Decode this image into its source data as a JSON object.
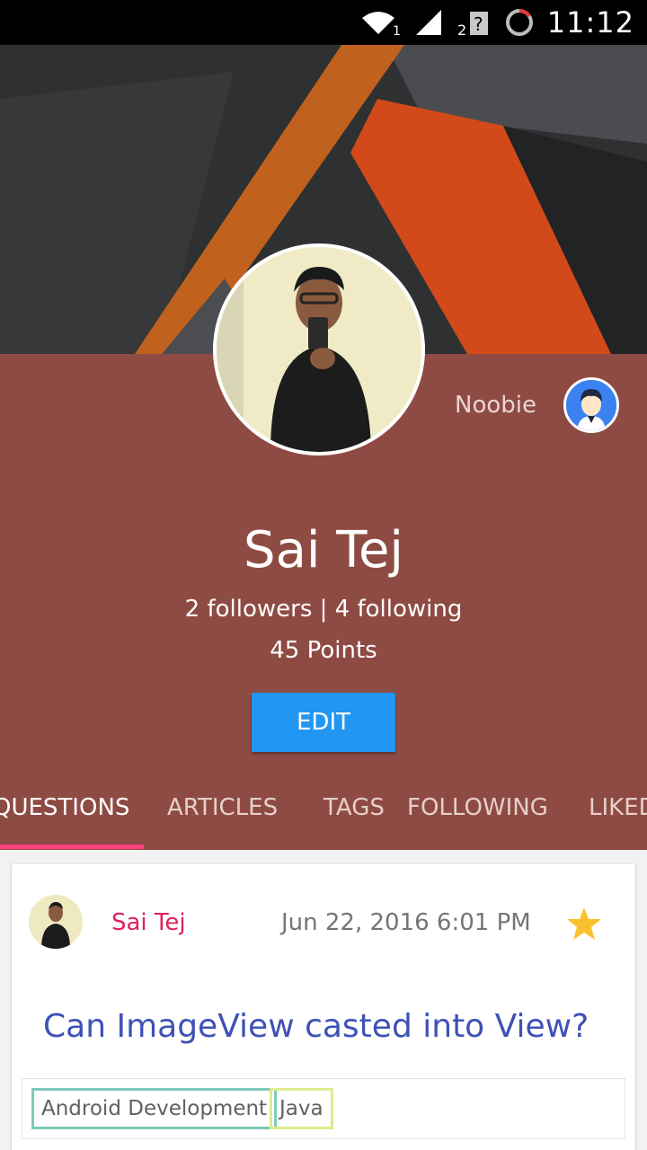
{
  "status_bar": {
    "time": "11:12",
    "icons": [
      "wifi-icon",
      "signal-icon",
      "no-sim-icon",
      "loading-ring-icon"
    ],
    "wifi_sub": "1",
    "signal_sub": "2"
  },
  "profile": {
    "name": "Sai Tej",
    "follow_text": "2 followers | 4 following",
    "points_text": "45 Points",
    "level_label": "Noobie",
    "edit_label": "EDIT"
  },
  "tabs": [
    {
      "label": "QUESTIONS",
      "active": true
    },
    {
      "label": "ARTICLES",
      "active": false
    },
    {
      "label": "TAGS",
      "active": false
    },
    {
      "label": "FOLLOWING",
      "active": false
    },
    {
      "label": "LIKED",
      "active": false
    }
  ],
  "feed": {
    "cards": [
      {
        "author": "Sai Tej",
        "date": "Jun 22, 2016 6:01 PM",
        "title": "Can ImageView casted into View?",
        "tags": [
          "Android Development",
          "Java"
        ],
        "starred": true
      }
    ]
  },
  "colors": {
    "panel": "#8e4b43",
    "accent_pink": "#ff4081",
    "edit_blue": "#2196f3",
    "title_blue": "#3f51b5",
    "author_pink": "#e0215b",
    "star_gold": "#fbc02d"
  }
}
